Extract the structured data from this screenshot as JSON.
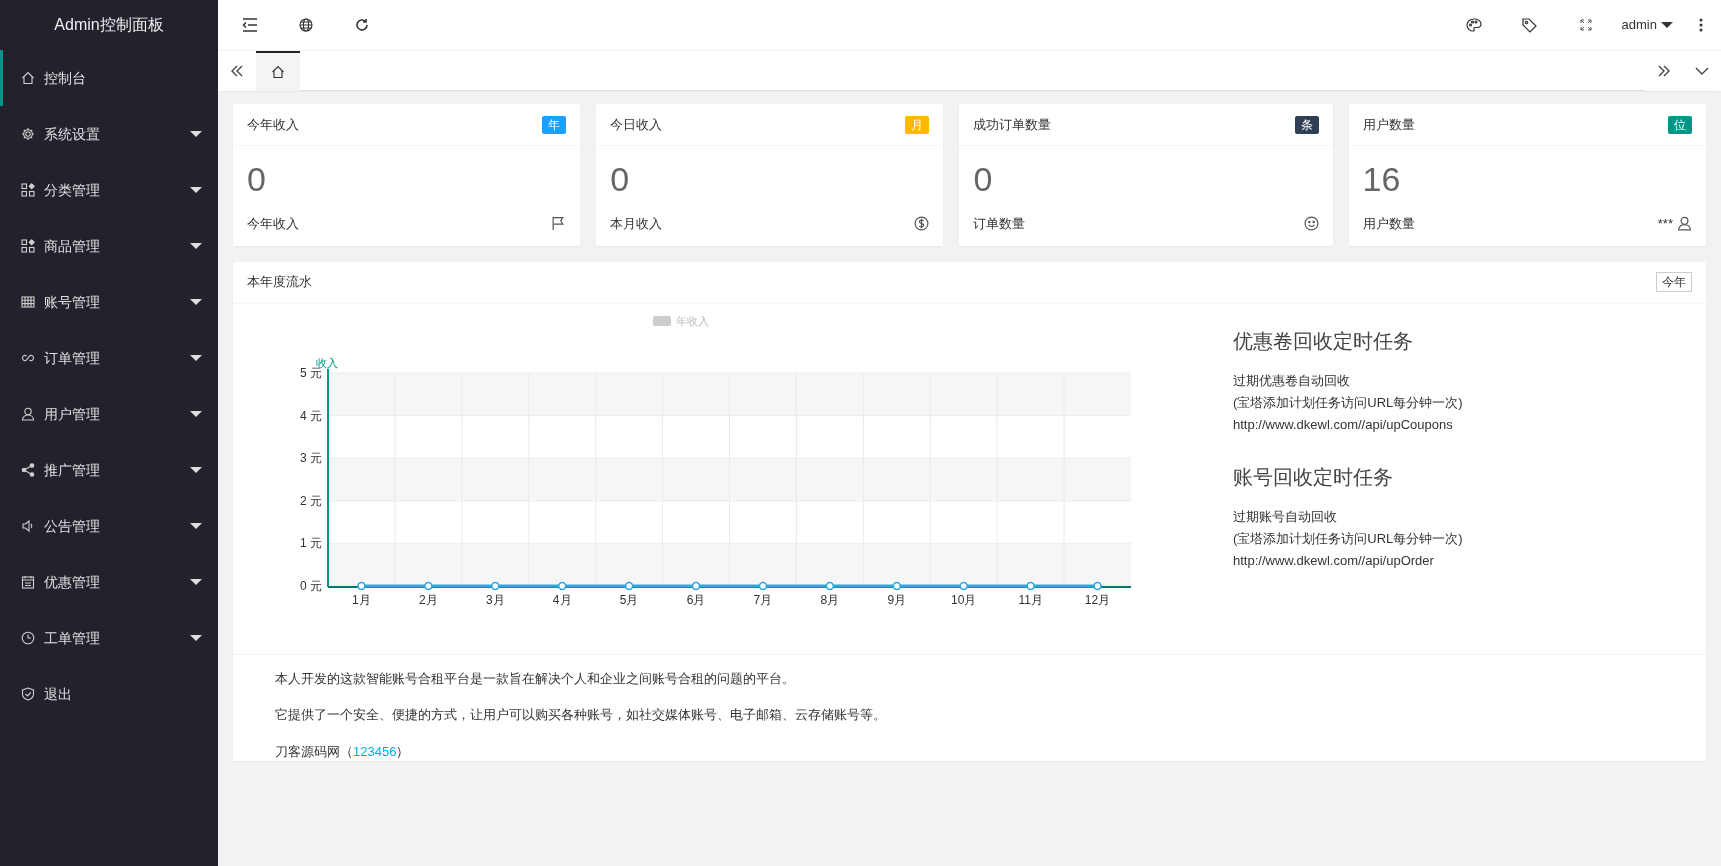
{
  "sidebar": {
    "title": "Admin控制面板",
    "items": [
      {
        "label": "控制台",
        "selected": true,
        "expandable": false
      },
      {
        "label": "系统设置",
        "selected": false,
        "expandable": true
      },
      {
        "label": "分类管理",
        "selected": false,
        "expandable": true
      },
      {
        "label": "商品管理",
        "selected": false,
        "expandable": true
      },
      {
        "label": "账号管理",
        "selected": false,
        "expandable": true
      },
      {
        "label": "订单管理",
        "selected": false,
        "expandable": true
      },
      {
        "label": "用户管理",
        "selected": false,
        "expandable": true
      },
      {
        "label": "推广管理",
        "selected": false,
        "expandable": true
      },
      {
        "label": "公告管理",
        "selected": false,
        "expandable": true
      },
      {
        "label": "优惠管理",
        "selected": false,
        "expandable": true
      },
      {
        "label": "工单管理",
        "selected": false,
        "expandable": true
      },
      {
        "label": "退出",
        "selected": false,
        "expandable": false
      }
    ]
  },
  "topbar": {
    "user": "admin"
  },
  "tabs": [
    {
      "kind": "home",
      "selected": true
    }
  ],
  "cards": [
    {
      "title": "今年收入",
      "badge": "年",
      "color": "#1e9fff",
      "value": "0",
      "label": "今年收入"
    },
    {
      "title": "今日收入",
      "badge": "月",
      "color": "#ffb800",
      "value": "0",
      "label": "本月收入"
    },
    {
      "title": "成功订单数量",
      "badge": "条",
      "color": "#2f4056",
      "value": "0",
      "label": "订单数量"
    },
    {
      "title": "用户数量",
      "badge": "位",
      "color": "#009688",
      "value": "16",
      "label": "用户数量",
      "note": "***"
    }
  ],
  "flow": {
    "title": "本年度流水",
    "button": "今年",
    "chart_data": {
      "type": "line",
      "ylabel": "收入",
      "categories": [
        "1月",
        "2月",
        "3月",
        "4月",
        "5月",
        "6月",
        "7月",
        "8月",
        "9月",
        "10月",
        "11月",
        "12月"
      ],
      "series": [
        {
          "name": "年收入",
          "color": "#2ea7e0",
          "marker": true,
          "values": [
            0,
            0,
            0,
            0,
            0,
            0,
            0,
            0,
            0,
            0,
            0,
            0
          ]
        }
      ],
      "ylim": [
        0,
        5
      ],
      "grid": true,
      "yticks": [
        {
          "value": 0,
          "label": "0 元"
        },
        {
          "value": 1,
          "label": "1 元"
        },
        {
          "value": 2,
          "label": "2 元"
        },
        {
          "value": 3,
          "label": "3 元"
        },
        {
          "value": 4,
          "label": "4 元"
        },
        {
          "value": 5,
          "label": "5 元"
        }
      ]
    },
    "tasks": [
      {
        "title": "优惠卷回收定时任务",
        "lines": [
          "过期优惠卷自动回收",
          "(宝塔添加计划任务访问URL每分钟一次)",
          "http://www.dkewl.com//api/upCoupons"
        ]
      },
      {
        "title": "账号回收定时任务",
        "lines": [
          "过期账号自动回收",
          "(宝塔添加计划任务访问URL每分钟一次)",
          "http://www.dkewl.com//api/upOrder"
        ]
      }
    ],
    "about": [
      "本人开发的这款智能账号合租平台是一款旨在解决个人和企业之间账号合租的问题的平台。",
      "它提供了一个安全、便捷的方式，让用户可以购买各种账号，如社交媒体账号、电子邮箱、云存储账号等。"
    ],
    "credit": {
      "prefix": "刀客源码网（",
      "link": "123456",
      "suffix": "）"
    }
  }
}
